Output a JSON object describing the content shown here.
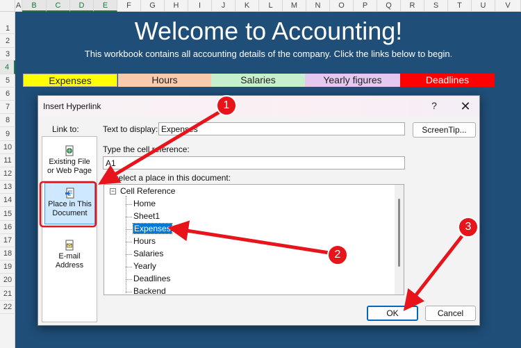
{
  "columns": [
    "A",
    "B",
    "C",
    "D",
    "E",
    "F",
    "G",
    "H",
    "I",
    "J",
    "K",
    "L",
    "M",
    "N",
    "O",
    "P",
    "Q",
    "R",
    "S",
    "T",
    "U",
    "V"
  ],
  "rows": [
    "1",
    "2",
    "3",
    "4",
    "5",
    "6",
    "7",
    "8",
    "9",
    "10",
    "11",
    "12",
    "13",
    "14",
    "15",
    "16",
    "17",
    "18",
    "19",
    "20",
    "21",
    "22"
  ],
  "sheet": {
    "title": "Welcome to Accounting!",
    "subtitle": "This workbook contains all accounting details of the company. Click the links below to begin.",
    "nav": [
      "Expenses",
      "Hours",
      "Salaries",
      "Yearly figures",
      "Deadlines"
    ]
  },
  "dialog": {
    "title": "Insert Hyperlink",
    "help": "?",
    "close": "✕",
    "link_to_label": "Link to:",
    "link_options": {
      "existing": [
        "Existing File",
        "or Web Page"
      ],
      "place": [
        "Place in This",
        "Document"
      ],
      "email": [
        "E-mail",
        "Address"
      ]
    },
    "text_to_display_label": "Text to display:",
    "text_to_display_value": "Expenses",
    "screentip_label": "ScreenTip...",
    "cell_ref_label": "Type the cell reference:",
    "cell_ref_value": "A1",
    "place_label": "Or select a place in this document:",
    "tree_root": "Cell Reference",
    "tree_items": [
      "Home",
      "Sheet1",
      "Expenses",
      "Hours",
      "Salaries",
      "Yearly",
      "Deadlines",
      "Backend"
    ],
    "ok_label": "OK",
    "cancel_label": "Cancel"
  },
  "annotations": [
    "1",
    "2",
    "3"
  ],
  "colors": {
    "sheet_bg": "#1f4e79",
    "expenses": "#ffff00",
    "hours": "#f8cbad",
    "salaries": "#c6efce",
    "yearly": "#e4c8f0",
    "deadlines": "#ff0000",
    "annotation_red": "#e8141b"
  }
}
